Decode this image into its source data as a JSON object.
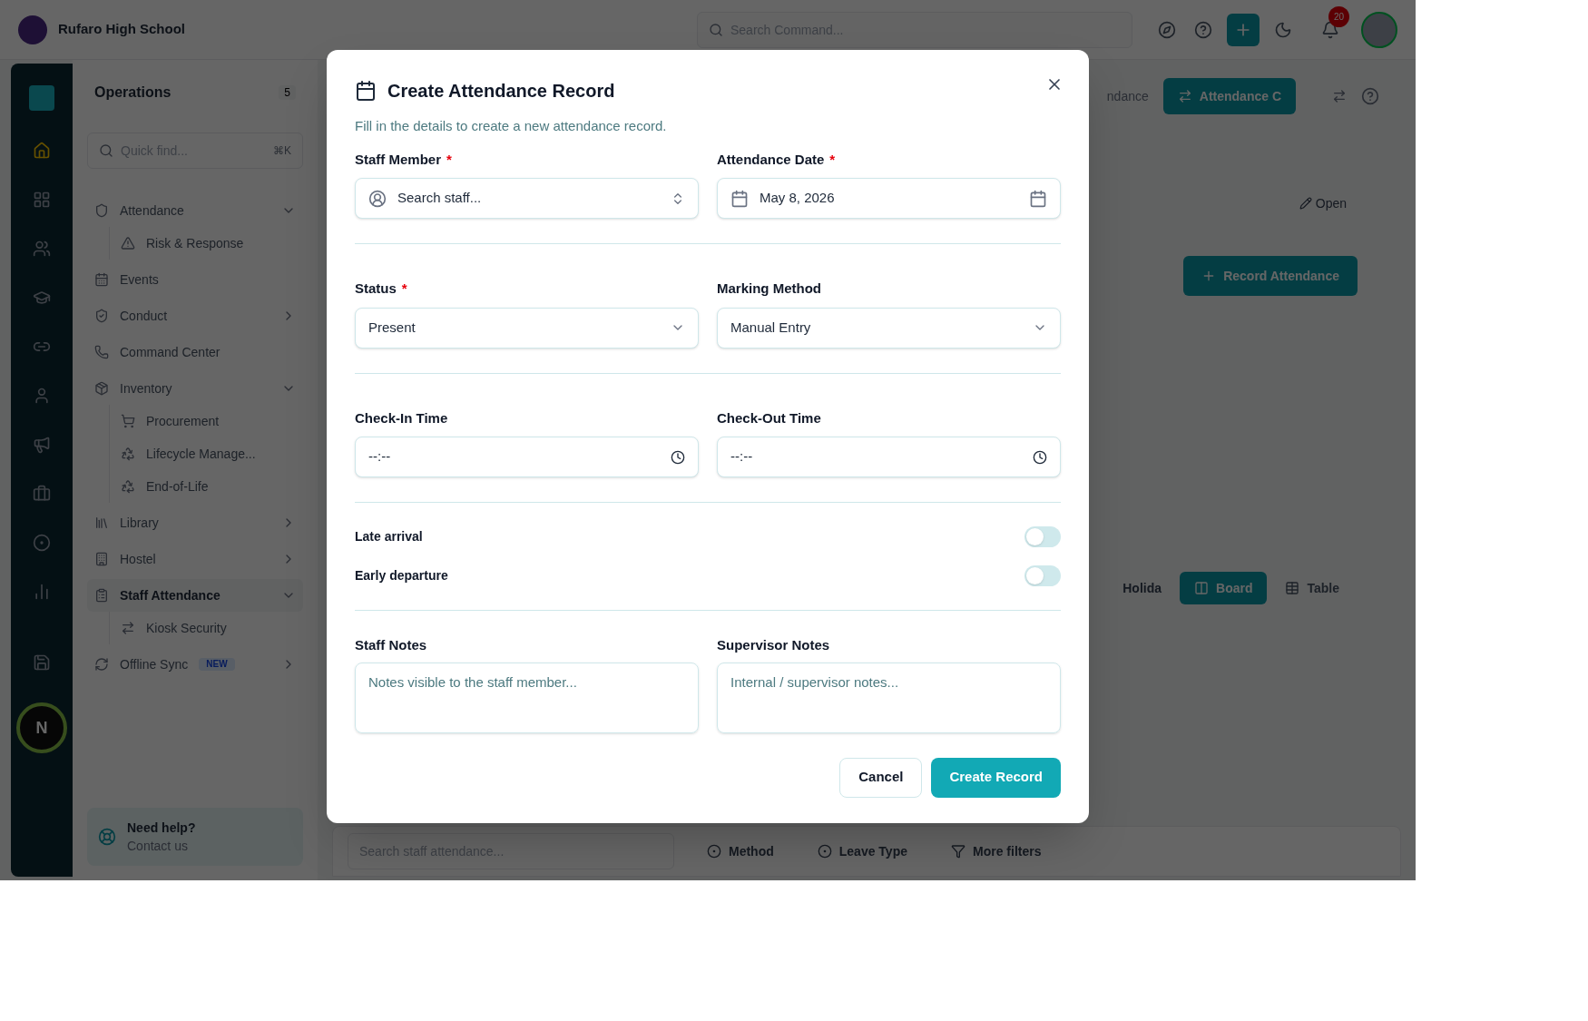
{
  "app": {
    "school_name": "Rufaro High School",
    "search": {
      "placeholder": "Search Command..."
    },
    "notification_count": "20"
  },
  "sidebar": {
    "title": "Operations",
    "count": "5",
    "quick_find": {
      "placeholder": "Quick find...",
      "shortcut": "⌘K"
    },
    "items": [
      {
        "label": "Attendance",
        "kind": "group",
        "expanded": true,
        "selected": false,
        "children": [
          {
            "label": "Risk & Response"
          }
        ]
      },
      {
        "label": "Events",
        "kind": "link",
        "selected": false
      },
      {
        "label": "Conduct",
        "kind": "group",
        "expanded": false,
        "selected": false
      },
      {
        "label": "Command Center",
        "kind": "link",
        "selected": false
      },
      {
        "label": "Inventory",
        "kind": "group",
        "expanded": true,
        "selected": false,
        "children": [
          {
            "label": "Procurement"
          },
          {
            "label": "Lifecycle Manage..."
          },
          {
            "label": "End-of-Life"
          }
        ]
      },
      {
        "label": "Library",
        "kind": "group",
        "expanded": false,
        "selected": false
      },
      {
        "label": "Hostel",
        "kind": "group",
        "expanded": false,
        "selected": false
      },
      {
        "label": "Staff Attendance",
        "kind": "group",
        "expanded": true,
        "selected": true,
        "children": [
          {
            "label": "Kiosk Security"
          }
        ]
      },
      {
        "label": "Offline Sync",
        "kind": "group",
        "expanded": false,
        "selected": false,
        "badge": "NEW"
      }
    ],
    "help": {
      "title": "Need help?",
      "link": "Contact us"
    },
    "assistant_label": "N"
  },
  "main": {
    "breadcrumb": "ndance",
    "tab_button": "Attendance C",
    "open_button": "Open",
    "record_button": "Record Attendance",
    "holiday_label": "Holida",
    "views": [
      {
        "label": "Board",
        "selected": true
      },
      {
        "label": "Table",
        "selected": false
      }
    ],
    "filter_bar": {
      "search_placeholder": "Search staff attendance...",
      "filters": [
        "Method",
        "Leave Type",
        "More filters"
      ]
    }
  },
  "dialog": {
    "title": "Create Attendance Record",
    "description": "Fill in the details to create a new attendance record.",
    "sections": [
      {
        "fields": [
          {
            "label": "Staff Member",
            "required_mark": "*",
            "kind": "combobox",
            "placeholder": "Search staff..."
          },
          {
            "label": "Attendance Date",
            "required_mark": "*",
            "kind": "date",
            "value": "May 8, 2026"
          }
        ]
      },
      {
        "fields": [
          {
            "label": "Status",
            "required_mark": "*",
            "kind": "select",
            "value": "Present"
          },
          {
            "label": "Marking Method",
            "kind": "select",
            "value": "Manual Entry"
          }
        ]
      },
      {
        "fields": [
          {
            "label": "Check-In Time",
            "kind": "time",
            "value": "--:--"
          },
          {
            "label": "Check-Out Time",
            "kind": "time",
            "value": "--:--"
          }
        ]
      }
    ],
    "toggles": [
      {
        "label": "Late arrival",
        "on": false
      },
      {
        "label": "Early departure",
        "on": false
      }
    ],
    "notes": [
      {
        "label": "Staff Notes",
        "placeholder": "Notes visible to the staff member..."
      },
      {
        "label": "Supervisor Notes",
        "placeholder": "Internal / supervisor notes..."
      }
    ],
    "buttons": {
      "cancel": "Cancel",
      "submit": "Create Record"
    }
  }
}
